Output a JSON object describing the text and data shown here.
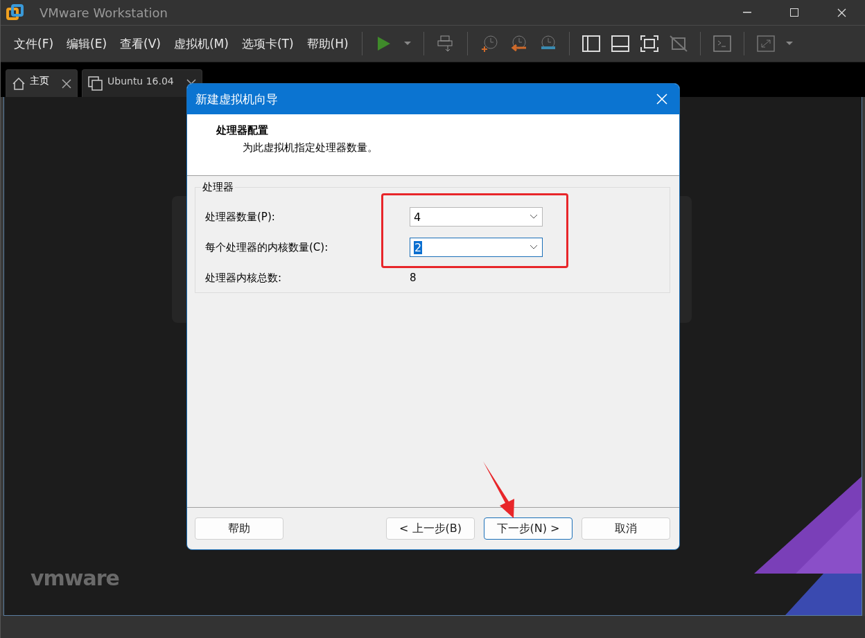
{
  "window": {
    "title": "VMware Workstation"
  },
  "menu": [
    "文件(F)",
    "编辑(E)",
    "查看(V)",
    "虚拟机(M)",
    "选项卡(T)",
    "帮助(H)"
  ],
  "tabs": [
    {
      "label": "主页",
      "kind": "home",
      "selected": true
    },
    {
      "label": "Ubuntu 16.04",
      "kind": "vm",
      "selected": false
    }
  ],
  "logo": "vmware",
  "dialog": {
    "title": "新建虚拟机向导",
    "heading": "处理器配置",
    "subheading": "为此虚拟机指定处理器数量。",
    "group": {
      "title": "处理器",
      "fields": [
        {
          "label": "处理器数量(P):",
          "value": "4",
          "focused": false
        },
        {
          "label": "每个处理器的内核数量(C):",
          "value": "2",
          "focused": true
        }
      ],
      "total_label": "处理器内核总数:",
      "total_value": "8"
    },
    "buttons": [
      {
        "label": "帮助",
        "default": false
      },
      {
        "label": "< 上一步(B)",
        "default": false
      },
      {
        "label": "下一步(N) >",
        "default": true
      },
      {
        "label": "取消",
        "default": false
      }
    ]
  }
}
